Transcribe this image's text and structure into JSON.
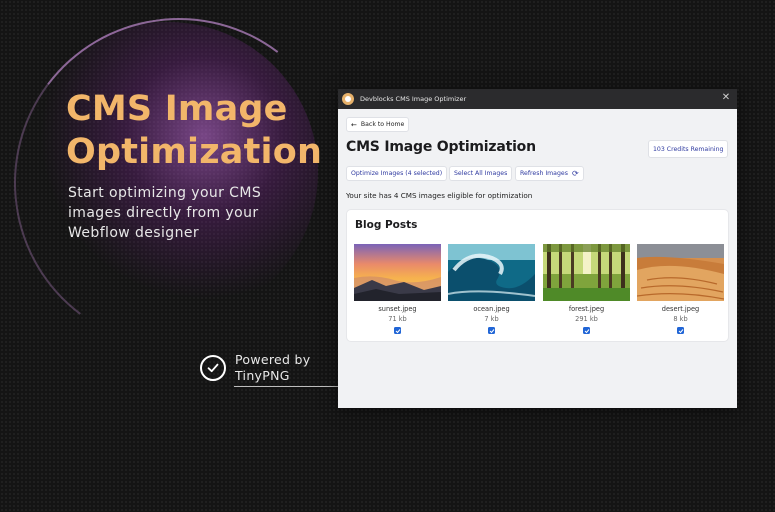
{
  "hero": {
    "title": "CMS Image Optimization",
    "subtitle": "Start optimizing your CMS images directly from your Webflow designer",
    "powered_by": "Powered by",
    "powered_brand": "TinyPNG"
  },
  "window": {
    "title": "Devblocks CMS Image Optimizer",
    "back_label": "Back to Home",
    "page_title": "CMS Image Optimization",
    "credits": "103 Credits Remaining",
    "toolbar": {
      "optimize_label": "Optimize Images (4 selected)",
      "select_all_label": "Select All Images",
      "refresh_label": "Refresh Images"
    },
    "eligible_text": "Your site has 4 CMS images eligible for optimization",
    "section_title": "Blog Posts",
    "images": [
      {
        "name": "sunset.jpeg",
        "size": "71 kb",
        "checked": true
      },
      {
        "name": "ocean.jpeg",
        "size": "7 kb",
        "checked": true
      },
      {
        "name": "forest.jpeg",
        "size": "291 kb",
        "checked": true
      },
      {
        "name": "desert.jpeg",
        "size": "8 kb",
        "checked": true
      }
    ]
  },
  "colors": {
    "accent": "#f2b66a",
    "link": "#2f3aa0",
    "checkbox": "#2065d6"
  }
}
